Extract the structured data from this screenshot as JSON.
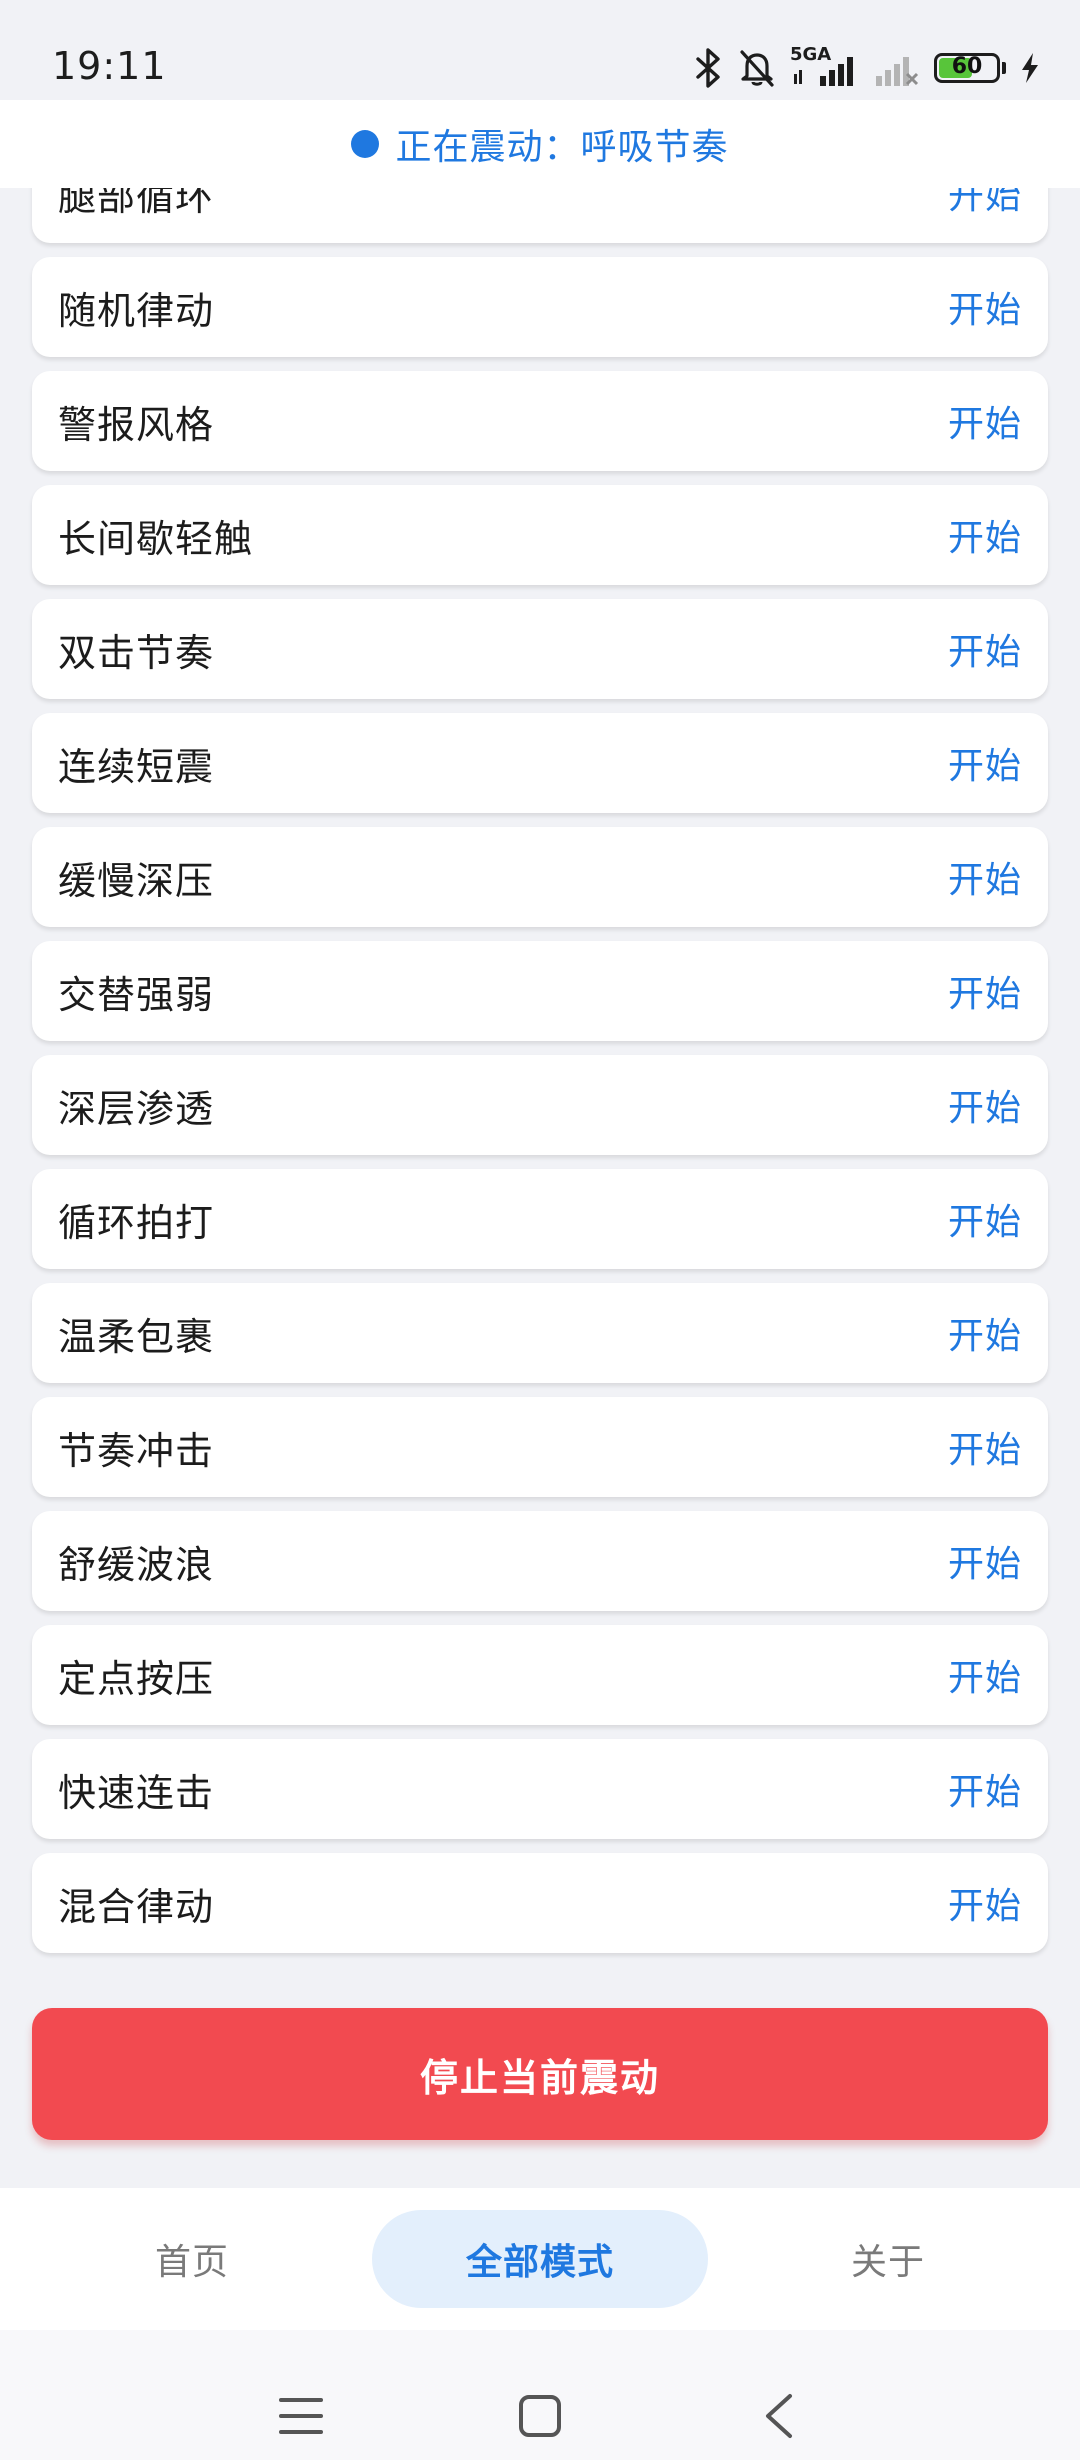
{
  "status_bar": {
    "time": "19:11",
    "network_label": "5GA",
    "battery_level": 60,
    "battery_text": "60",
    "icons": [
      "bluetooth-icon",
      "bell-muted-icon",
      "signal-5g-icon",
      "signal-no-service-icon",
      "battery-icon",
      "charging-icon"
    ]
  },
  "banner": {
    "text": "正在震动：呼吸节奏",
    "dot_color": "#1f78e0"
  },
  "modes": [
    {
      "label": "腿部循环",
      "action": "开始"
    },
    {
      "label": "随机律动",
      "action": "开始"
    },
    {
      "label": "警报风格",
      "action": "开始"
    },
    {
      "label": "长间歇轻触",
      "action": "开始"
    },
    {
      "label": "双击节奏",
      "action": "开始"
    },
    {
      "label": "连续短震",
      "action": "开始"
    },
    {
      "label": "缓慢深压",
      "action": "开始"
    },
    {
      "label": "交替强弱",
      "action": "开始"
    },
    {
      "label": "深层渗透",
      "action": "开始"
    },
    {
      "label": "循环拍打",
      "action": "开始"
    },
    {
      "label": "温柔包裹",
      "action": "开始"
    },
    {
      "label": "节奏冲击",
      "action": "开始"
    },
    {
      "label": "舒缓波浪",
      "action": "开始"
    },
    {
      "label": "定点按压",
      "action": "开始"
    },
    {
      "label": "快速连击",
      "action": "开始"
    },
    {
      "label": "混合律动",
      "action": "开始"
    }
  ],
  "stop_button": {
    "label": "停止当前震动",
    "color": "#f24a50"
  },
  "bottom_nav": {
    "items": [
      {
        "label": "首页",
        "active": false
      },
      {
        "label": "全部模式",
        "active": true
      },
      {
        "label": "关于",
        "active": false
      }
    ]
  },
  "system_nav": {
    "icons": [
      "menu-icon",
      "home-square-icon",
      "back-chevron-icon"
    ]
  },
  "colors": {
    "accent": "#1f78e0",
    "accent_soft": "#e3effc",
    "danger": "#f24a50",
    "background": "#f1f2f6"
  }
}
